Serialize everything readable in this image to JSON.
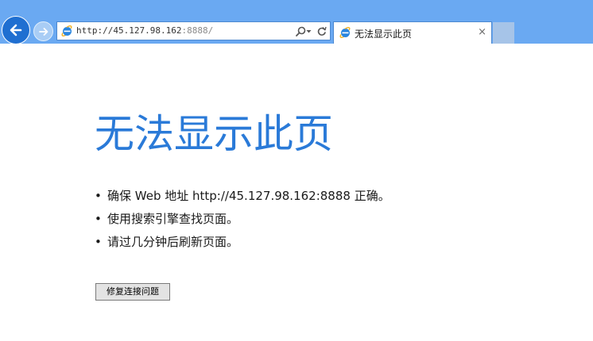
{
  "browser": {
    "address": {
      "url_main": "http://45.127.98.162",
      "url_port": ":8888/"
    },
    "tab": {
      "title": "无法显示此页",
      "close_glyph": "×"
    },
    "icons": {
      "back": "back-arrow-icon",
      "forward": "forward-arrow-icon",
      "page": "ie-logo-icon",
      "search": "search-icon",
      "dropdown": "dropdown-icon",
      "refresh": "refresh-icon"
    }
  },
  "page": {
    "heading": "无法显示此页",
    "bullet_glyph": "•",
    "tips": [
      "确保 Web 地址 http://45.127.98.162:8888 正确。",
      "使用搜索引擎查找页面。",
      "请过几分钟后刷新页面。"
    ],
    "fix_button_label": "修复连接问题"
  },
  "colors": {
    "chrome_bg": "#6aa9f2",
    "heading_blue": "#2a7ad8",
    "back_button": "#1f6fd1"
  }
}
